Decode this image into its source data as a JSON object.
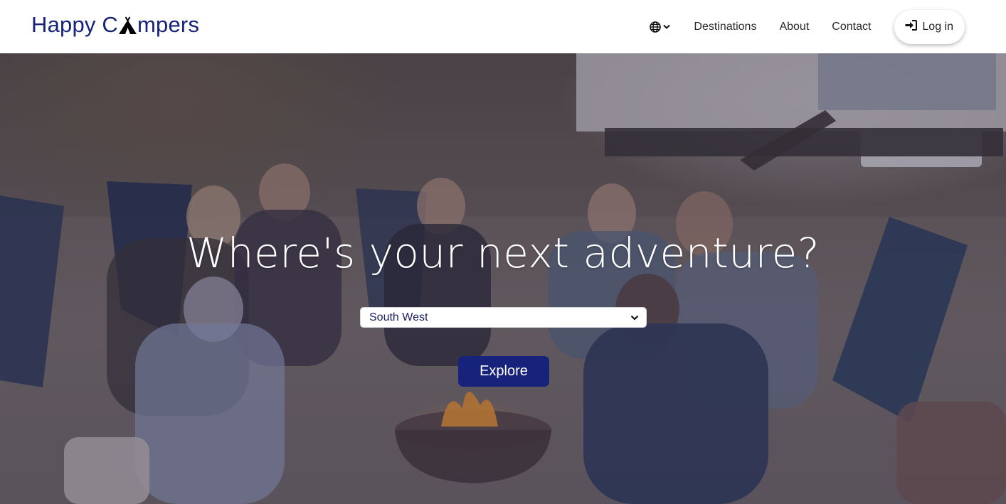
{
  "brand": {
    "name_start": "Happy C",
    "name_end": "mpers",
    "color": "#17237a",
    "logo_icon": "tent-icon"
  },
  "nav": {
    "language_icon": "globe-icon",
    "language_chevron": "chevron-down-icon",
    "links": [
      {
        "label": "Destinations"
      },
      {
        "label": "About"
      },
      {
        "label": "Contact"
      }
    ],
    "login": {
      "label": "Log in",
      "icon": "sign-in-icon"
    }
  },
  "hero": {
    "headline": "Where's your next adventure?",
    "region_select": {
      "selected": "South West",
      "icon": "chevron-down-icon"
    },
    "explore_label": "Explore",
    "accent_color": "#17237a"
  }
}
